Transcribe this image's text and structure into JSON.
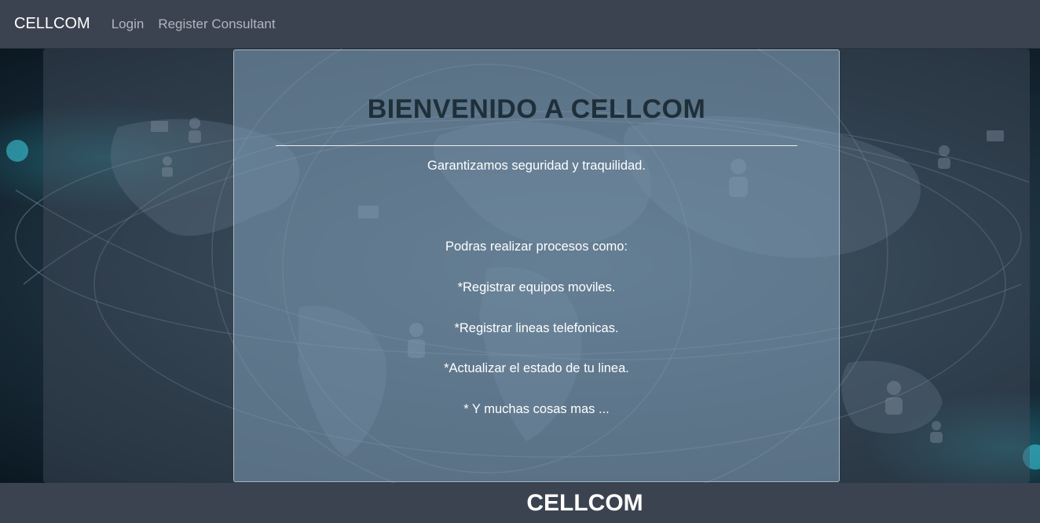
{
  "navbar": {
    "brand": "CELLCOM",
    "links": [
      "Login",
      "Register Consultant"
    ]
  },
  "card": {
    "title": "BIENVENIDO A CELLCOM",
    "tagline": "Garantizamos seguridad y traquilidad.",
    "intro": "Podras realizar procesos como:",
    "items": [
      "*Registrar equipos moviles.",
      "*Registrar lineas telefonicas.",
      "*Actualizar el estado de tu linea.",
      "* Y muchas cosas mas ..."
    ]
  },
  "footer": {
    "brand": "CELLCOM"
  },
  "colors": {
    "navbar_bg": "#3c4350",
    "title": "#1f2f3a",
    "nav_link": "#b0b6bf"
  },
  "background_image": "world-map-network-icon"
}
